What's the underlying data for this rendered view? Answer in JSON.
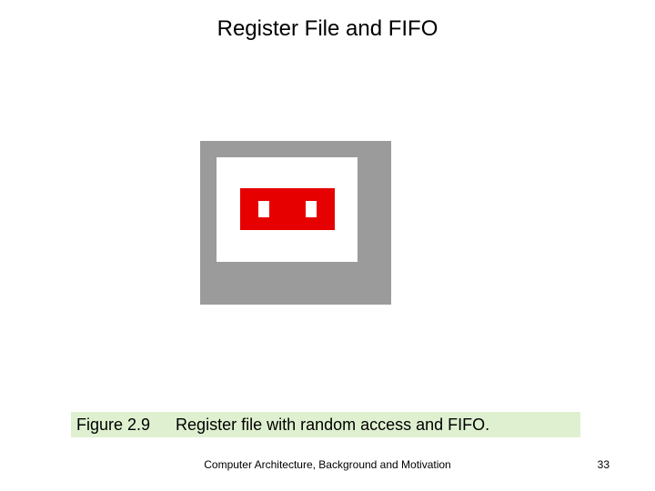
{
  "title": "Register File and FIFO",
  "figure": {
    "label": "Figure 2.9",
    "caption": "Register file with random access and FIFO."
  },
  "footer": "Computer Architecture, Background and Motivation",
  "page_number": "33"
}
